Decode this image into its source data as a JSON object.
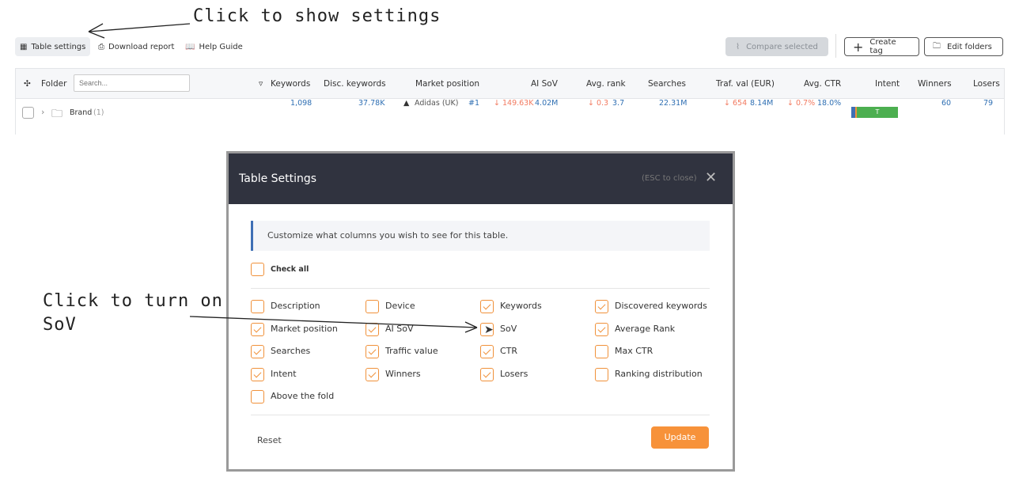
{
  "annotations": {
    "top": "Click to show settings",
    "side_line1": "Click to turn on",
    "side_line2": "SoV"
  },
  "toolbar": {
    "table_settings": "Table settings",
    "download_report": "Download report",
    "help_guide": "Help Guide",
    "compare_selected": "Compare selected",
    "create_tag": "Create tag",
    "edit_folders": "Edit folders"
  },
  "table": {
    "folder_label": "Folder",
    "search_placeholder": "Search...",
    "headers": [
      "Keywords",
      "Disc. keywords",
      "Market position",
      "AI SoV",
      "Avg. rank",
      "Searches",
      "Traf. val (EUR)",
      "Avg. CTR",
      "Intent",
      "Winners",
      "Losers"
    ],
    "row": {
      "name": "Brand",
      "count": "(1)",
      "keywords": "1,098",
      "disc_keywords": "37.78K",
      "market_brand": "Adidas (UK)",
      "market_rank": "#1",
      "ai_sov_delta": "149.63K",
      "ai_sov": "4.02M",
      "avg_rank_delta": "0.3",
      "avg_rank": "3.7",
      "searches": "22.31M",
      "traf_delta": "654",
      "traf_val": "8.14M",
      "ctr_delta": "0.7%",
      "ctr": "18.0%",
      "intent": "T",
      "winners": "60",
      "losers": "79"
    }
  },
  "modal": {
    "title": "Table Settings",
    "esc_hint": "(ESC to close)",
    "info": "Customize what columns you wish to see for this table.",
    "check_all": "Check all",
    "reset": "Reset",
    "update": "Update",
    "options": [
      {
        "label": "Description",
        "checked": false
      },
      {
        "label": "Device",
        "checked": false
      },
      {
        "label": "Keywords",
        "checked": true
      },
      {
        "label": "Discovered keywords",
        "checked": true
      },
      {
        "label": "Market position",
        "checked": true
      },
      {
        "label": "AI SoV",
        "checked": true
      },
      {
        "label": "SoV",
        "checked": false
      },
      {
        "label": "Average Rank",
        "checked": true
      },
      {
        "label": "Searches",
        "checked": true
      },
      {
        "label": "Traffic value",
        "checked": true
      },
      {
        "label": "CTR",
        "checked": true
      },
      {
        "label": "Max CTR",
        "checked": false
      },
      {
        "label": "Intent",
        "checked": true
      },
      {
        "label": "Winners",
        "checked": true
      },
      {
        "label": "Losers",
        "checked": true
      },
      {
        "label": "Ranking distribution",
        "checked": false
      },
      {
        "label": "Above the fold",
        "checked": false
      }
    ]
  },
  "colors": {
    "accent": "#f7923a",
    "link": "#2f6fb3",
    "header_bg": "#30333f",
    "delta_down": "#f27a60",
    "intent_green": "#4caf50"
  }
}
